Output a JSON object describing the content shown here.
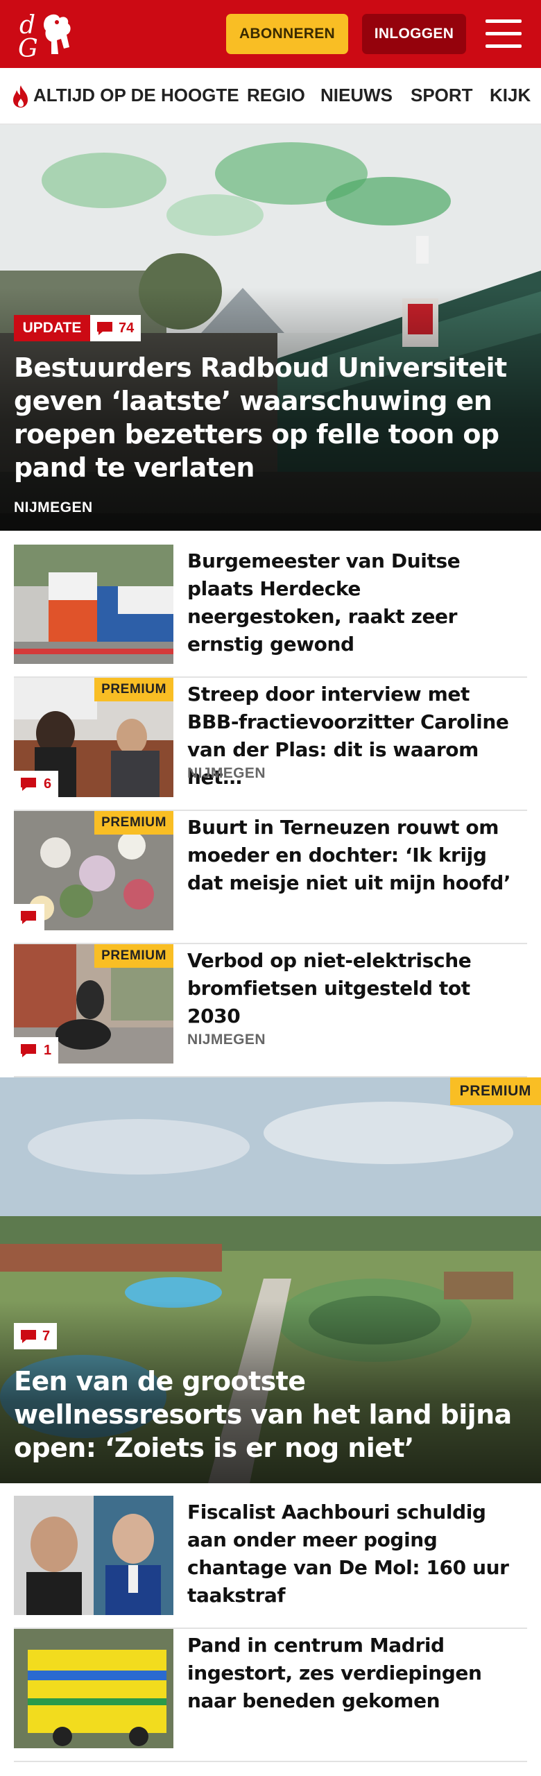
{
  "header": {
    "logo_text": "dG",
    "subscribe_label": "ABONNEREN",
    "login_label": "INLOGGEN",
    "menu_icon": "hamburger-icon"
  },
  "nav": {
    "items": [
      "ALTIJD OP DE HOOGTE",
      "REGIO",
      "NIEUWS",
      "SPORT",
      "KIJK"
    ]
  },
  "hero1": {
    "label": "UPDATE",
    "comments": "74",
    "title": "Bestuurders Radboud Universiteit geven ‘laatste’ waarschuwing en roepen bezetters op felle toon op pand te verlaten",
    "city": "NIJMEGEN"
  },
  "articles1": [
    {
      "title": "Burgemeester van Duitse plaats Herdecke neergestoken, raakt zeer ernstig gewond",
      "premium": "",
      "comments": "",
      "city": ""
    },
    {
      "title": "Streep door interview met BBB-fractievoorzitter Caroline van der Plas: dit is waarom het…",
      "premium": "PREMIUM",
      "comments": "6",
      "city": "NIJMEGEN"
    },
    {
      "title": "Buurt in Terneuzen rouwt om moeder en dochter: ‘Ik krijg dat meisje niet uit mijn hoofd’",
      "premium": "PREMIUM",
      "comments": "",
      "city": ""
    },
    {
      "title": "Verbod op niet-elektrische bromfietsen uitgesteld tot 2030",
      "premium": "PREMIUM",
      "comments": "1",
      "city": "NIJMEGEN"
    }
  ],
  "hero2": {
    "premium": "PREMIUM",
    "comments": "7",
    "title": "Een van de grootste wellnessresorts van het land bijna open: ‘Zoiets is er nog niet’"
  },
  "articles2": [
    {
      "title": "Fiscalist Aachbouri schuldig aan onder meer poging chantage van De Mol: 160 uur taakstraf"
    },
    {
      "title": "Pand in centrum Madrid ingestort, zes verdiepingen naar beneden gekomen"
    }
  ],
  "colors": {
    "brand_red": "#cc0a14",
    "premium_yellow": "#f9be24",
    "login_dark": "#95020c"
  }
}
